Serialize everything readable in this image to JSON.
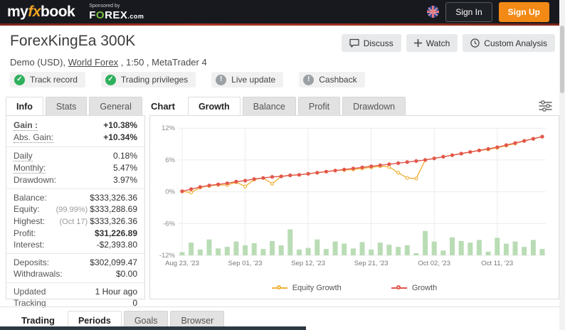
{
  "header": {
    "logo_my": "my",
    "logo_fx": "fx",
    "logo_book": "book",
    "sponsored_by": "Sponsored by",
    "sponsor_brand_pre": "F",
    "sponsor_brand_o": "O",
    "sponsor_brand_post": "REX",
    "sponsor_tld": ".com",
    "sign_in": "Sign In",
    "sign_up": "Sign Up"
  },
  "title_bar": {
    "title": "ForexKingEa 300K",
    "buttons": [
      {
        "label": "Discuss",
        "icon": "discuss-icon"
      },
      {
        "label": "Watch",
        "icon": "plus-icon"
      },
      {
        "label": "Custom Analysis",
        "icon": "clock-icon"
      }
    ]
  },
  "subtitle": {
    "prefix": "Demo (USD), ",
    "link": "World Forex",
    "suffix": " , 1:50 , MetaTrader 4"
  },
  "badges": [
    {
      "label": "Track record",
      "status": "ok"
    },
    {
      "label": "Trading privileges",
      "status": "ok"
    },
    {
      "label": "Live update",
      "status": "warn"
    },
    {
      "label": "Cashback",
      "status": "warn"
    }
  ],
  "info_panel": {
    "tabs": [
      "Info",
      "Stats",
      "General"
    ],
    "active_tab": "Info",
    "rows": [
      {
        "label": "Gain :",
        "value": "+10.38%",
        "vclass": "green",
        "lclass": "strong",
        "underline": true
      },
      {
        "label": "Abs. Gain:",
        "value": "+10.34%",
        "vclass": "green",
        "underline": true
      },
      {
        "divider": true
      },
      {
        "label": "Daily",
        "value": "0.18%",
        "underline": true
      },
      {
        "label": "Monthly:",
        "value": "5.47%",
        "underline": true
      },
      {
        "label": "Drawdown:",
        "value": "3.97%"
      },
      {
        "divider": true
      },
      {
        "label": "Balance:",
        "value": "$333,326.36"
      },
      {
        "label": "Equity:",
        "pre": "(99.99%) ",
        "value": "$333,288.69"
      },
      {
        "label": "Highest:",
        "pre": "(Oct 17) ",
        "value": "$333,326.36"
      },
      {
        "label": "Profit:",
        "value": "$31,226.89",
        "vclass": "green"
      },
      {
        "label": "Interest:",
        "value": "-$2,393.80"
      },
      {
        "divider": true
      },
      {
        "label": "Deposits:",
        "value": "$302,099.47"
      },
      {
        "label": "Withdrawals:",
        "value": "$0.00"
      },
      {
        "divider": true
      },
      {
        "label": "Updated",
        "value": "1 Hour ago"
      },
      {
        "label": "Tracking",
        "value": "0"
      }
    ]
  },
  "chart_card": {
    "section_label": "Chart",
    "tabs": [
      "Growth",
      "Balance",
      "Profit",
      "Drawdown"
    ],
    "active_tab": "Growth"
  },
  "chart_data": {
    "type": "line",
    "title": "",
    "xlabel": "",
    "ylabel": "",
    "ylim": [
      -12,
      12
    ],
    "y_ticks": [
      12,
      6,
      0,
      -6,
      -12
    ],
    "y_tick_labels": [
      "12%",
      "6%",
      "0%",
      "-6%",
      "-12%"
    ],
    "x_tick_labels": [
      "Aug 23, '23",
      "Sep 01, '23",
      "Sep 12, '23",
      "Sep 21, '23",
      "Oct 02, '23",
      "Oct 11, '23"
    ],
    "x_tick_indices": [
      0,
      7,
      14,
      21,
      28,
      35
    ],
    "grid": true,
    "legend_position": "bottom",
    "series": [
      {
        "name": "Equity Growth",
        "type": "line",
        "color": "#f0b33c",
        "hollow": true,
        "values": [
          0.05,
          -0.15,
          0.8,
          1.1,
          1.3,
          1.25,
          1.8,
          1.0,
          2.3,
          2.6,
          1.5,
          2.9,
          3.1,
          3.2,
          3.4,
          3.6,
          3.8,
          4.0,
          4.1,
          4.2,
          4.4,
          4.6,
          4.8,
          4.7,
          3.6,
          2.6,
          2.5,
          6.0,
          6.3,
          6.6,
          6.9,
          7.2,
          7.5,
          7.8,
          8.0,
          8.3,
          8.7,
          9.1,
          9.6,
          10.0,
          10.4
        ]
      },
      {
        "name": "Growth",
        "type": "line",
        "color": "#e2574c",
        "hollow": false,
        "values": [
          0.1,
          0.5,
          0.9,
          1.2,
          1.4,
          1.6,
          1.9,
          2.1,
          2.4,
          2.6,
          2.8,
          2.9,
          3.1,
          3.2,
          3.4,
          3.6,
          3.8,
          4.0,
          4.2,
          4.4,
          4.6,
          4.8,
          5.0,
          5.2,
          5.4,
          5.6,
          5.8,
          6.0,
          6.3,
          6.6,
          6.9,
          7.2,
          7.5,
          7.8,
          8.1,
          8.4,
          8.8,
          9.2,
          9.6,
          10.0,
          10.4
        ]
      },
      {
        "name": "Activity",
        "type": "bar",
        "color": "#b9dcb5",
        "values": [
          0.6,
          2.4,
          1.1,
          3.0,
          1.3,
          1.6,
          2.6,
          1.9,
          2.3,
          1.2,
          2.7,
          1.9,
          4.9,
          1.1,
          1.4,
          3.0,
          1.2,
          2.6,
          2.2,
          1.3,
          2.5,
          1.1,
          2.4,
          2.0,
          1.6,
          1.9,
          0.4,
          4.6,
          2.6,
          0.9,
          3.4,
          2.7,
          2.4,
          2.9,
          0.7,
          3.3,
          2.2,
          2.6,
          1.6,
          2.9,
          1.2
        ]
      }
    ],
    "legend": [
      {
        "label": "Equity Growth",
        "color": "#f0b33c"
      },
      {
        "label": "Growth",
        "color": "#e2574c"
      }
    ]
  },
  "bottom_tabs": {
    "section_label": "Trading",
    "tabs": [
      "Periods",
      "Goals",
      "Browser"
    ],
    "active_tab": "Periods"
  },
  "colors": {
    "accent_orange": "#f28a15",
    "gain_green": "#18a644",
    "badge_green": "#2eb05c",
    "badge_gray": "#9aa0a6",
    "header_bg": "#17191e",
    "red_divider": "#96301f"
  }
}
